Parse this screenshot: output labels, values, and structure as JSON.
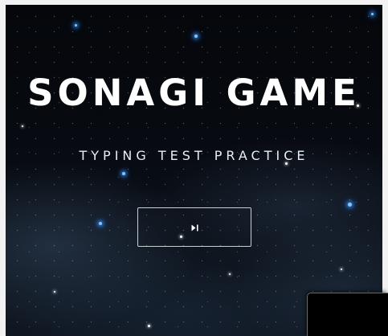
{
  "game": {
    "title": "SONAGI GAME",
    "subtitle": "TYPING TEST PRACTICE"
  },
  "start_button": {
    "icon": "play-pause-icon"
  },
  "colors": {
    "background": "#05070b",
    "text": "#ffffff",
    "button_border": "#c9ced4",
    "star_glow": "#7fc6ff"
  }
}
